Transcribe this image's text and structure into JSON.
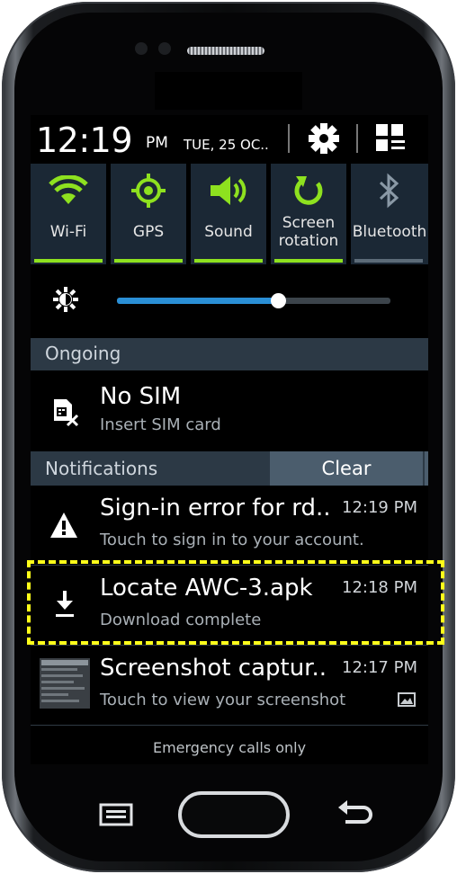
{
  "status": {
    "time": "12:19",
    "ampm": "PM",
    "date": "TUE, 25 OC.."
  },
  "quick_settings": [
    {
      "label": "Wi-Fi",
      "icon": "wifi-icon",
      "active": true
    },
    {
      "label": "GPS",
      "icon": "gps-icon",
      "active": true
    },
    {
      "label": "Sound",
      "icon": "sound-icon",
      "active": true
    },
    {
      "label_line1": "Screen",
      "label_line2": "rotation",
      "icon": "rotation-icon",
      "active": true
    },
    {
      "label": "Bluetooth",
      "icon": "bluetooth-icon",
      "active": false
    }
  ],
  "brightness": {
    "level": 0.59,
    "icon": "brightness-icon"
  },
  "ongoing": {
    "header": "Ongoing",
    "item": {
      "title": "No SIM",
      "subtitle": "Insert SIM card",
      "icon": "no-sim-icon"
    }
  },
  "notifications": {
    "header": "Notifications",
    "clear_label": "Clear",
    "items": [
      {
        "title": "Sign-in error for rd..",
        "subtitle": "Touch to sign in to your account.",
        "time": "12:19 PM",
        "icon": "warning-icon"
      },
      {
        "title": "Locate AWC-3.apk",
        "subtitle": "Download complete",
        "time": "12:18 PM",
        "icon": "download-icon"
      },
      {
        "title": "Screenshot captur..",
        "subtitle": "Touch to view your screenshot",
        "time": "12:17 PM",
        "icon": "screenshot-thumbnail"
      }
    ]
  },
  "footer": {
    "emergency": "Emergency calls only"
  },
  "colors": {
    "accent": "#8ee11f",
    "highlight": "#ffff1a",
    "slider": "#2a8fd6"
  }
}
